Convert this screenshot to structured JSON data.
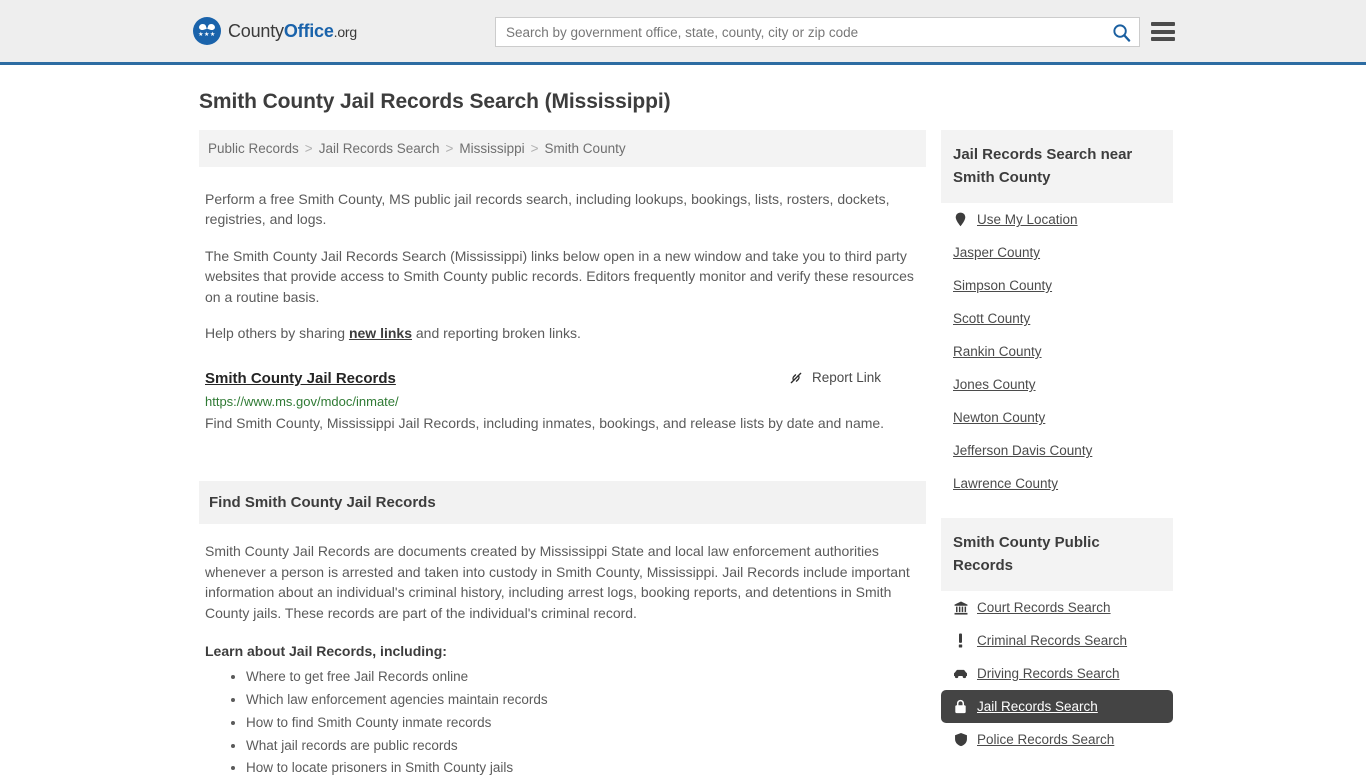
{
  "header": {
    "logo": {
      "part1": "County",
      "part2": "Office",
      "part3": ".org",
      "icon": "eagle-logo-icon"
    },
    "search": {
      "placeholder": "Search by government office, state, county, city or zip code",
      "value": "",
      "icon": "search-icon"
    },
    "menu_icon": "hamburger-menu-icon"
  },
  "page": {
    "title": "Smith County Jail Records Search (Mississippi)"
  },
  "breadcrumb": {
    "separator": ">",
    "items": [
      {
        "label": "Public Records"
      },
      {
        "label": "Jail Records Search"
      },
      {
        "label": "Mississippi"
      },
      {
        "label": "Smith County"
      }
    ]
  },
  "intro": {
    "p1": "Perform a free Smith County, MS public jail records search, including lookups, bookings, lists, rosters, dockets, registries, and logs.",
    "p2": "The Smith County Jail Records Search (Mississippi) links below open in a new window and take you to third party websites that provide access to Smith County public records. Editors frequently monitor and verify these resources on a routine basis.",
    "p3_before": "Help others by sharing ",
    "p3_link": "new links",
    "p3_after": " and reporting broken links."
  },
  "result": {
    "title": "Smith County Jail Records",
    "url": "https://www.ms.gov/mdoc/inmate/",
    "description": "Find Smith County, Mississippi Jail Records, including inmates, bookings, and release lists by date and name.",
    "report_label": "Report Link",
    "report_icon": "broken-link-icon"
  },
  "section": {
    "heading": "Find Smith County Jail Records",
    "body": "Smith County Jail Records are documents created by Mississippi State and local law enforcement authorities whenever a person is arrested and taken into custody in Smith County, Mississippi. Jail Records include important information about an individual's criminal history, including arrest logs, booking reports, and detentions in Smith County jails. These records are part of the individual's criminal record.",
    "learn_title": "Learn about Jail Records, including:",
    "bullets": [
      "Where to get free Jail Records online",
      "Which law enforcement agencies maintain records",
      "How to find Smith County inmate records",
      "What jail records are public records",
      "How to locate prisoners in Smith County jails"
    ]
  },
  "sidebar": {
    "nearby": {
      "heading": "Jail Records Search near Smith County",
      "use_location": {
        "label": "Use My Location",
        "icon": "map-pin-icon"
      },
      "counties": [
        {
          "label": "Jasper County"
        },
        {
          "label": "Simpson County"
        },
        {
          "label": "Scott County"
        },
        {
          "label": "Rankin County"
        },
        {
          "label": "Jones County"
        },
        {
          "label": "Newton County"
        },
        {
          "label": "Jefferson Davis County"
        },
        {
          "label": "Lawrence County"
        }
      ]
    },
    "public_records": {
      "heading": "Smith County Public Records",
      "items": [
        {
          "label": "Court Records Search",
          "icon": "courthouse-icon",
          "active": false
        },
        {
          "label": "Criminal Records Search",
          "icon": "exclamation-icon",
          "active": false
        },
        {
          "label": "Driving Records Search",
          "icon": "car-icon",
          "active": false
        },
        {
          "label": "Jail Records Search",
          "icon": "lock-icon",
          "active": true
        },
        {
          "label": "Police Records Search",
          "icon": "shield-icon",
          "active": false
        }
      ]
    }
  },
  "colors": {
    "brand_blue": "#1a63ab",
    "header_border": "#2d6ca2",
    "header_bg": "#eeeeee",
    "url_green": "#2f7a34",
    "active_bg": "#444444",
    "panel_bg": "#f3f3f3"
  }
}
